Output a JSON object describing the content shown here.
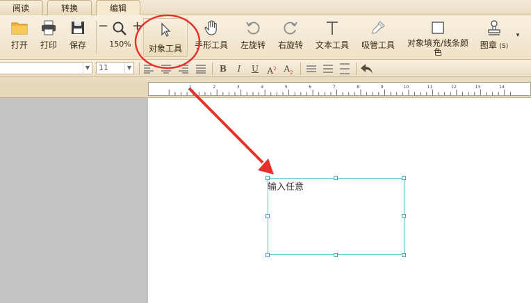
{
  "tabs": [
    {
      "label": "阅读",
      "active": false
    },
    {
      "label": "转换",
      "active": false
    },
    {
      "label": "编辑",
      "active": true
    }
  ],
  "toolbar": {
    "open_label": "打开",
    "print_label": "打印",
    "save_label": "保存",
    "zoom_out_symbol": "−",
    "zoom_in_symbol": "+",
    "zoom_level": "150%",
    "object_tool_label": "对象工具",
    "hand_tool_label": "手形工具",
    "rotate_left_label": "左旋转",
    "rotate_right_label": "右旋转",
    "text_tool_label": "文本工具",
    "eyedropper_label": "吸管工具",
    "fill_color_label_line1": "对象填充/线条颜",
    "fill_color_label_line2": "色",
    "stamp_label": "图章",
    "stamp_shortcut": "(S)",
    "more_symbol": "▾"
  },
  "format_bar": {
    "font_family_value": "",
    "font_size_value": "11",
    "bold_label": "B",
    "italic_label": "I",
    "underline_label": "U",
    "superscript_label": "A",
    "superscript_mark": "2",
    "subscript_label": "A",
    "subscript_mark": "2"
  },
  "ruler": {
    "labels": [
      "1",
      "2",
      "3",
      "4",
      "5",
      "6",
      "7",
      "8",
      "9",
      "10",
      "11",
      "12",
      "13",
      "14"
    ]
  },
  "document": {
    "textbox_text": "输入任意"
  },
  "colors": {
    "annotation_red": "#e8302a",
    "selection_cyan": "#5bc1cf",
    "ribbon_bg": "#f3e8d2",
    "workspace_gray": "#c5c4c2"
  }
}
